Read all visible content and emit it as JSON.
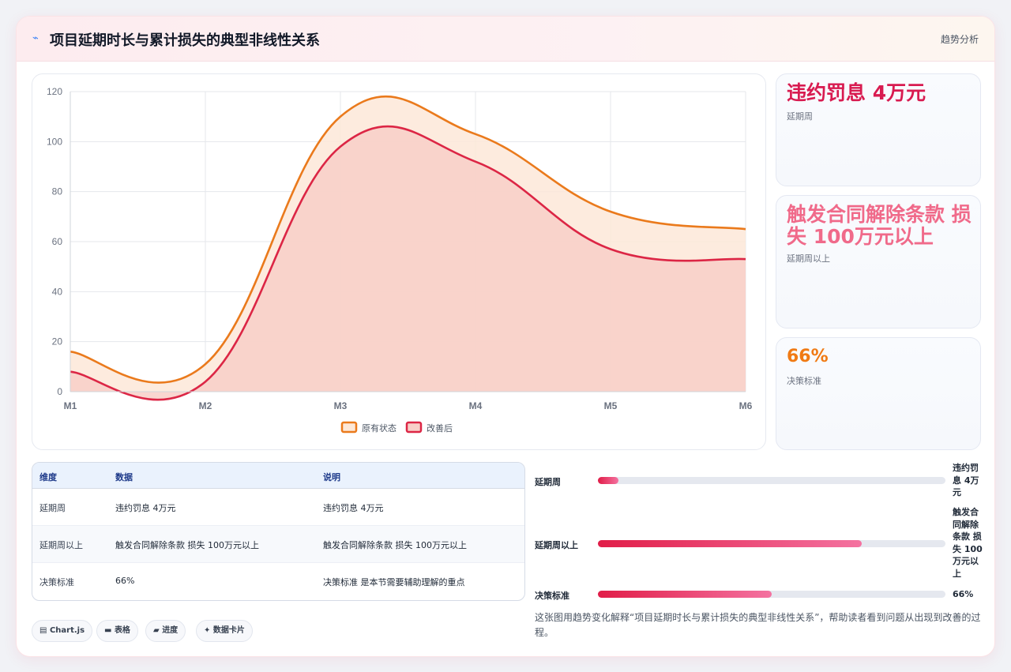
{
  "header": {
    "icon": "trend-line-icon",
    "title": "项目延期时长与累计损失的典型非线性关系",
    "tag": "趋势分析"
  },
  "chart_data": {
    "type": "area",
    "title": "",
    "xlabel": "",
    "ylabel": "",
    "categories": [
      "M1",
      "M2",
      "M3",
      "M4",
      "M5",
      "M6"
    ],
    "ylim": [
      0,
      120
    ],
    "yticks": [
      0,
      20,
      40,
      60,
      80,
      100,
      120
    ],
    "grid": true,
    "legend_position": "bottom",
    "series": [
      {
        "name": "原有状态",
        "color": "#ea7a1c",
        "fill": "#fde8d8",
        "values": [
          16,
          11,
          110,
          103,
          72,
          65
        ]
      },
      {
        "name": "改善后",
        "color": "#dc2645",
        "fill": "#f8cfc8",
        "values": [
          8,
          4,
          98,
          92,
          57,
          53
        ]
      }
    ]
  },
  "stats": [
    {
      "value": "违约罚息 4万元",
      "label": "延期周",
      "color": "#d81b50"
    },
    {
      "value": "触发合同解除条款 损失 100万元以上",
      "label": "延期周以上",
      "color": "#f06a8a"
    },
    {
      "value": "66%",
      "label": "决策标准",
      "color": "#f07a14"
    }
  ],
  "table": {
    "headers": [
      "维度",
      "数据",
      "说明"
    ],
    "rows": [
      [
        "延期周",
        "违约罚息 4万元",
        "违约罚息 4万元"
      ],
      [
        "延期周以上",
        "触发合同解除条款 损失 100万元以上",
        "触发合同解除条款 损失 100万元以上"
      ],
      [
        "决策标准",
        "66%",
        "决策标准 是本节需要辅助理解的重点"
      ]
    ]
  },
  "chips": [
    {
      "icon": "chart-icon",
      "glyph": "▤",
      "label": "Chart.js"
    },
    {
      "icon": "table-icon",
      "glyph": "▬",
      "label": "表格"
    },
    {
      "icon": "folder-icon",
      "glyph": "▰",
      "label": "进度"
    },
    {
      "icon": "sparkle-icon",
      "glyph": "✦",
      "label": "数据卡片"
    }
  ],
  "progress": [
    {
      "label": "延期周",
      "value_text": "违约罚息 4万元",
      "fraction": 0.06
    },
    {
      "label": "延期周以上",
      "value_text": "触发合同解除条款 损失 100万元以上",
      "fraction": 0.76
    },
    {
      "label": "决策标准",
      "value_text": "66%",
      "fraction": 0.5
    }
  ],
  "caption": "这张图用趋势变化解释“项目延期时长与累计损失的典型非线性关系”，帮助读者看到问题从出现到改善的过程。"
}
